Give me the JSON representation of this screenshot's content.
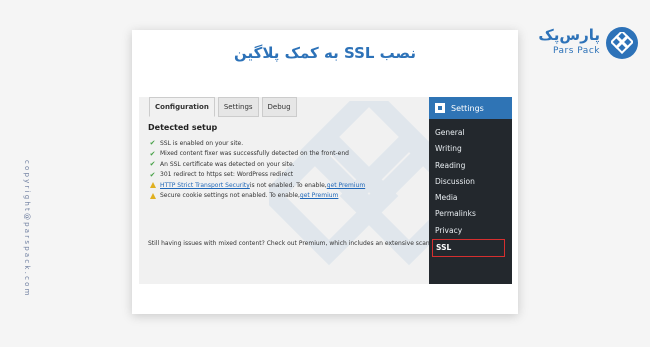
{
  "side_copyright": "copyright@parspack.com",
  "brand": {
    "name_fa": "پارس‌پک",
    "name_en": "Pars Pack"
  },
  "headline": "نصب SSL به کمک پلاگین",
  "tabs": [
    "Configuration",
    "Settings",
    "Debug"
  ],
  "section_title": "Detected setup",
  "items": [
    {
      "icon": "check",
      "text": "SSL is enabled on your site."
    },
    {
      "icon": "check",
      "text": "Mixed content fixer was successfully detected on the front-end"
    },
    {
      "icon": "check",
      "text": "An SSL certificate was detected on your site."
    },
    {
      "icon": "check",
      "text": "301 redirect to https set: WordPress redirect"
    },
    {
      "icon": "warning",
      "link": "HTTP Strict Transport Security",
      "text": " is not enabled. To enable, ",
      "cta": "get Premium"
    },
    {
      "icon": "warning",
      "text": "Secure cookie settings not enabled. To enable, ",
      "cta": "get Premium"
    }
  ],
  "footer_text": "Still having issues with mixed content? Check out Premium, which includes an extensive scan and",
  "sidebar": {
    "header": "Settings",
    "items": [
      "General",
      "Writing",
      "Reading",
      "Discussion",
      "Media",
      "Permalinks",
      "Privacy",
      "SSL"
    ]
  },
  "colors": {
    "brand_blue": "#2d72b8",
    "sidebar_bg": "#23282d",
    "active_blue": "#2f74b5",
    "highlight_red": "#d62f2f"
  }
}
